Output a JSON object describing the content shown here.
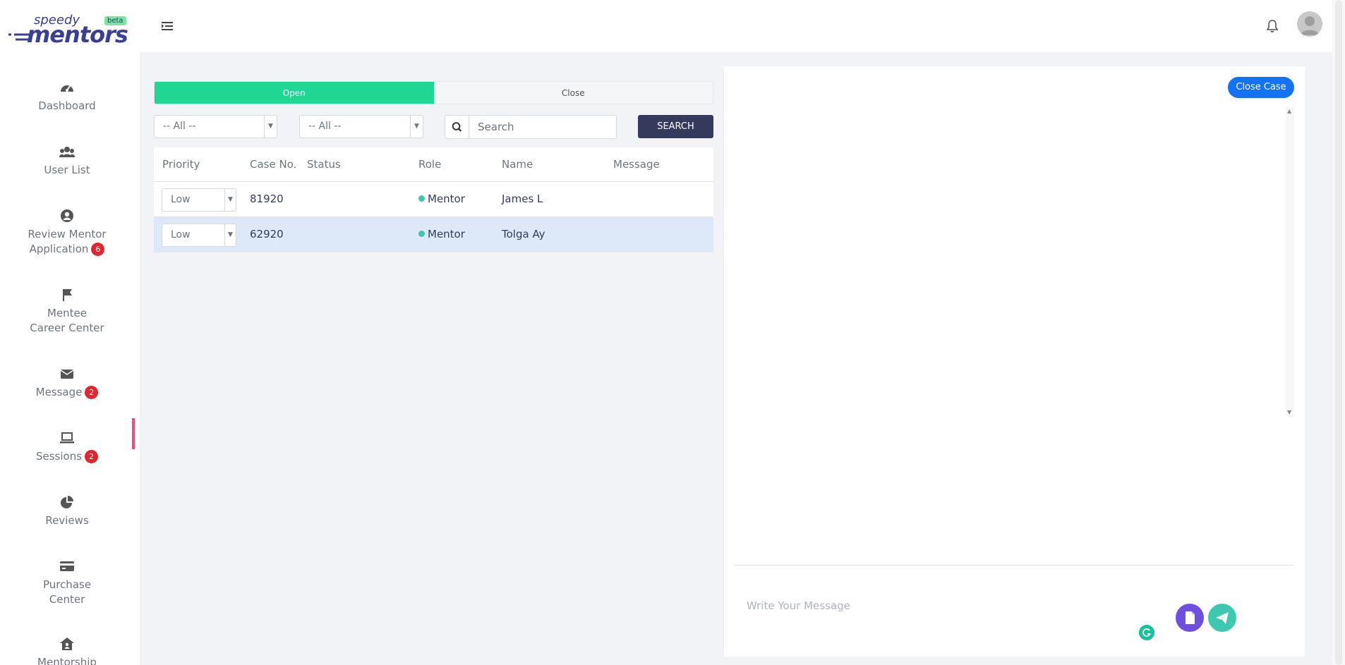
{
  "brand": {
    "name_top": "speedy",
    "name_main": "mentors",
    "badge": "beta"
  },
  "sidebar": {
    "items": [
      {
        "label": "Dashboard",
        "icon": "gauge-icon"
      },
      {
        "label": "User List",
        "icon": "users-icon"
      },
      {
        "label_line1": "Review Mentor",
        "label_line2": "Application",
        "badge": "6",
        "icon": "user-circle-icon"
      },
      {
        "label_line1": "Mentee",
        "label_line2": "Career Center",
        "icon": "flag-icon"
      },
      {
        "label": "Message",
        "badge": "2",
        "icon": "envelope-icon",
        "active": true
      },
      {
        "label": "Sessions",
        "badge": "2",
        "icon": "laptop-icon"
      },
      {
        "label": "Reviews",
        "icon": "pie-chart-icon"
      },
      {
        "label_line1": "Purchase",
        "label_line2": "Center",
        "icon": "credit-card-icon"
      },
      {
        "label": "Mentorship",
        "icon": "house-user-icon"
      }
    ]
  },
  "tabs": [
    {
      "label": "Open",
      "active": true
    },
    {
      "label": "Close",
      "active": false
    }
  ],
  "filters": {
    "filter1": "-- All --",
    "filter2": "-- All --",
    "search_placeholder": "Search",
    "search_button": "SEARCH"
  },
  "table": {
    "columns": [
      "Priority",
      "Case No.",
      "Status",
      "Role",
      "Name",
      "Message"
    ],
    "rows": [
      {
        "priority": "Low",
        "case_no": "81920",
        "status": "",
        "role": "Mentor",
        "name": "James L",
        "message": ""
      },
      {
        "priority": "Low",
        "case_no": "62920",
        "status": "",
        "role": "Mentor",
        "name": "Tolga Ay",
        "message": ""
      }
    ]
  },
  "chat": {
    "close_case_label": "Close Case",
    "message_placeholder": "Write Your Message"
  },
  "colors": {
    "accent_green": "#1fd692",
    "button_dark": "#343a5c",
    "close_case_blue": "#1473f5",
    "badge_red": "#e0262f",
    "active_indicator": "#ec4c7e",
    "attach_purple": "#6e4fe0",
    "send_teal": "#3ec8b0"
  }
}
